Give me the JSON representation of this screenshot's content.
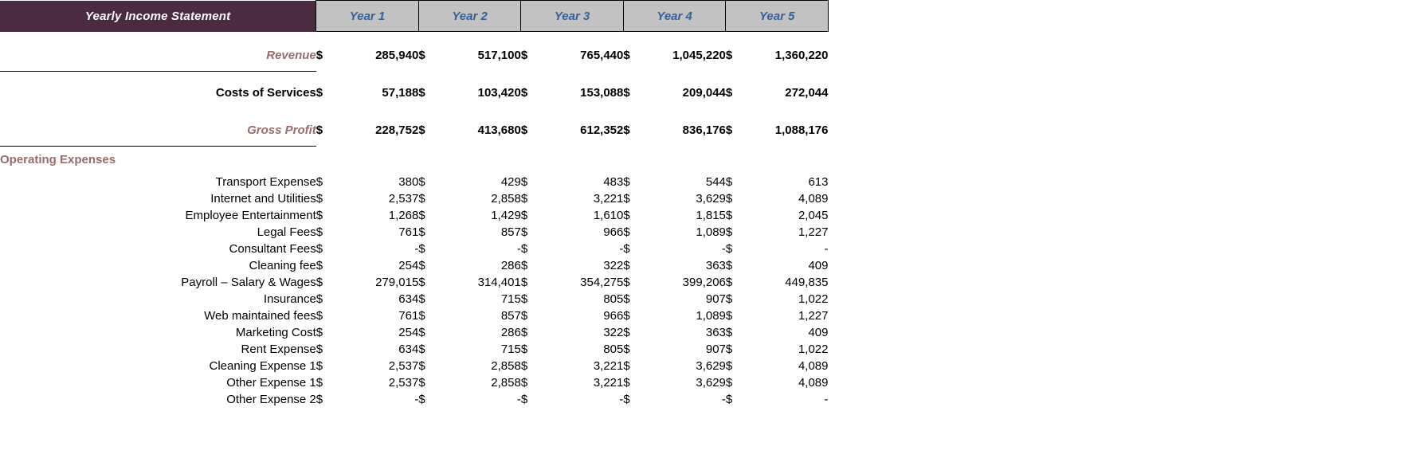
{
  "header": {
    "title": "Yearly Income Statement",
    "title_bg": "#4a2b41",
    "title_fg": "#ffffff",
    "year_header_bg": "#c2c2c2",
    "year_header_fg": "#35609a",
    "accent_color": "#9a6b6b",
    "columns": [
      "Year 1",
      "Year 2",
      "Year 3",
      "Year 4",
      "Year 5"
    ]
  },
  "currency_symbol": "$",
  "summary": [
    {
      "label": "Revenue",
      "style": "accent",
      "values": [
        "285,940",
        "517,100",
        "765,440",
        "1,045,220",
        "1,360,220"
      ]
    },
    {
      "label": "Costs of Services",
      "style": "plain",
      "values": [
        "57,188",
        "103,420",
        "153,088",
        "209,044",
        "272,044"
      ]
    },
    {
      "label": "Gross Profit",
      "style": "accent",
      "values": [
        "228,752",
        "413,680",
        "612,352",
        "836,176",
        "1,088,176"
      ]
    }
  ],
  "operating_expenses": {
    "heading": "Operating Expenses",
    "rows": [
      {
        "label": "Transport Expense",
        "values": [
          "380",
          "429",
          "483",
          "544",
          "613"
        ]
      },
      {
        "label": "Internet and Utilities",
        "values": [
          "2,537",
          "2,858",
          "3,221",
          "3,629",
          "4,089"
        ]
      },
      {
        "label": "Employee Entertainment",
        "values": [
          "1,268",
          "1,429",
          "1,610",
          "1,815",
          "2,045"
        ]
      },
      {
        "label": "Legal Fees",
        "values": [
          "761",
          "857",
          "966",
          "1,089",
          "1,227"
        ]
      },
      {
        "label": "Consultant Fees",
        "values": [
          "-",
          "-",
          "-",
          "-",
          "-"
        ]
      },
      {
        "label": "Cleaning fee",
        "values": [
          "254",
          "286",
          "322",
          "363",
          "409"
        ]
      },
      {
        "label": "Payroll – Salary & Wages",
        "values": [
          "279,015",
          "314,401",
          "354,275",
          "399,206",
          "449,835"
        ]
      },
      {
        "label": "Insurance",
        "values": [
          "634",
          "715",
          "805",
          "907",
          "1,022"
        ]
      },
      {
        "label": "Web maintained fees",
        "values": [
          "761",
          "857",
          "966",
          "1,089",
          "1,227"
        ]
      },
      {
        "label": "Marketing Cost",
        "values": [
          "254",
          "286",
          "322",
          "363",
          "409"
        ]
      },
      {
        "label": "Rent Expense",
        "values": [
          "634",
          "715",
          "805",
          "907",
          "1,022"
        ]
      },
      {
        "label": "Cleaning Expense 1",
        "values": [
          "2,537",
          "2,858",
          "3,221",
          "3,629",
          "4,089"
        ]
      },
      {
        "label": "Other Expense 1",
        "values": [
          "2,537",
          "2,858",
          "3,221",
          "3,629",
          "4,089"
        ]
      },
      {
        "label": "Other Expense 2",
        "values": [
          "-",
          "-",
          "-",
          "-",
          "-"
        ]
      }
    ]
  }
}
